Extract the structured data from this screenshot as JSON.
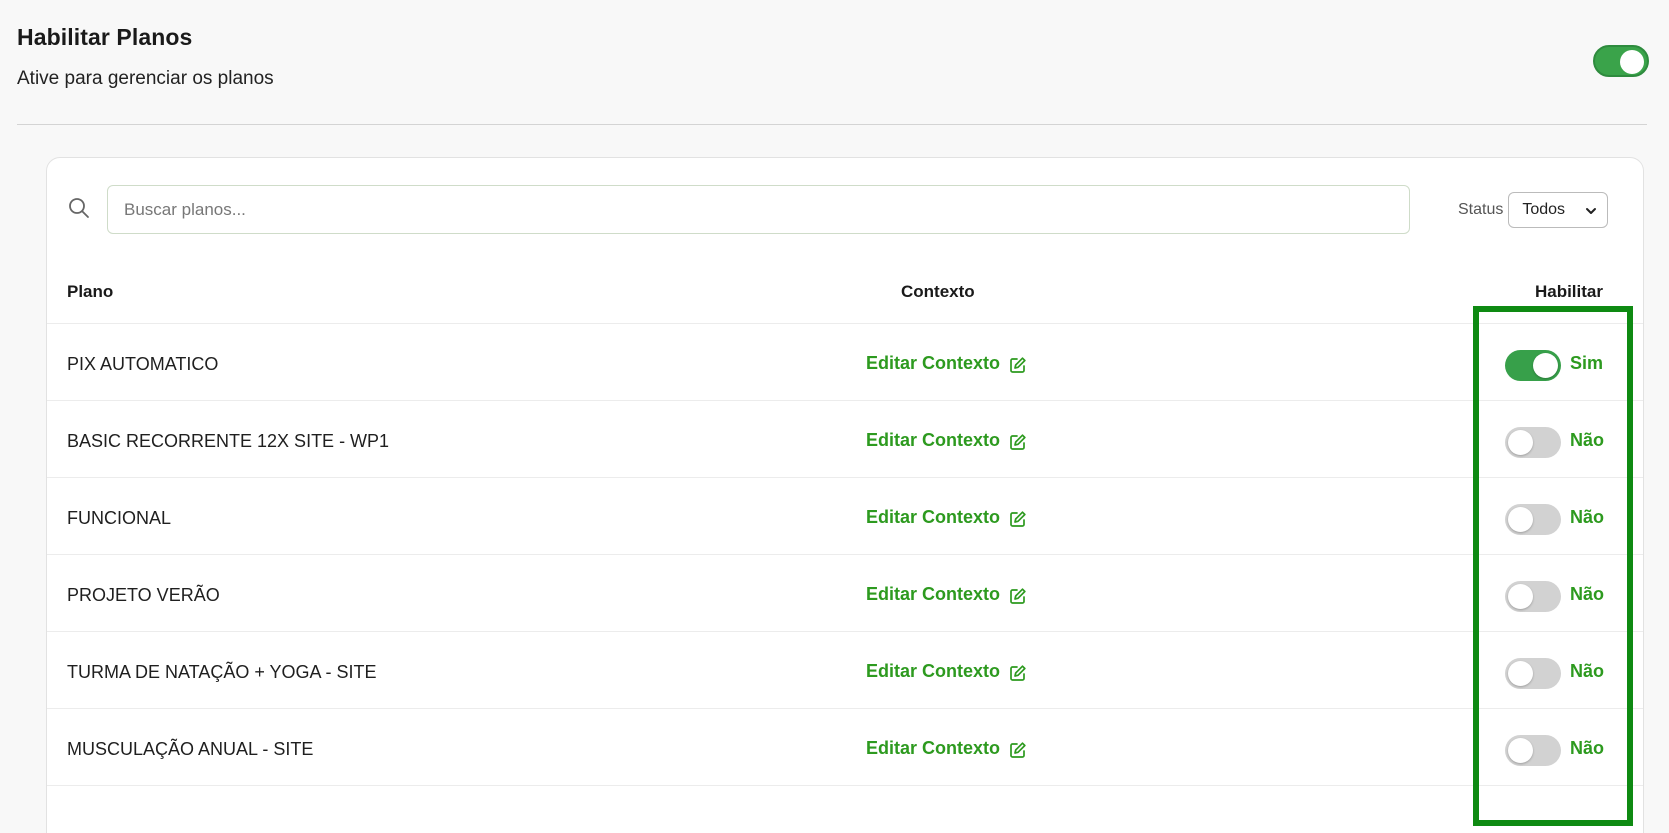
{
  "header": {
    "title": "Habilitar Planos",
    "subtitle": "Ative para gerenciar os planos",
    "master_toggle_on": true
  },
  "search": {
    "placeholder": "Buscar planos...",
    "value": ""
  },
  "status_filter": {
    "label": "Status",
    "selected": "Todos"
  },
  "table": {
    "headers": {
      "plano": "Plano",
      "contexto": "Contexto",
      "habilitar": "Habilitar"
    },
    "rows": [
      {
        "plan": "PIX AUTOMATICO",
        "action": "Editar Contexto",
        "enabled": true,
        "enabled_label": "Sim"
      },
      {
        "plan": "BASIC RECORRENTE 12X SITE - WP1",
        "action": "Editar Contexto",
        "enabled": false,
        "enabled_label": "Não"
      },
      {
        "plan": "FUNCIONAL",
        "action": "Editar Contexto",
        "enabled": false,
        "enabled_label": "Não"
      },
      {
        "plan": "PROJETO VERÃO",
        "action": "Editar Contexto",
        "enabled": false,
        "enabled_label": "Não"
      },
      {
        "plan": "TURMA DE NATAÇÃO + YOGA - SITE",
        "action": "Editar Contexto",
        "enabled": false,
        "enabled_label": "Não"
      },
      {
        "plan": "MUSCULAÇÃO ANUAL - SITE",
        "action": "Editar Contexto",
        "enabled": false,
        "enabled_label": "Não"
      }
    ]
  },
  "colors": {
    "accent_green": "#2d9a1f",
    "toggle_on": "#37a04a",
    "toggle_off": "#d2d2d2",
    "highlight_border": "#0e8a12"
  },
  "icons": {
    "search": "search-icon",
    "edit": "edit-icon",
    "dropdown": "chevron-down-icon"
  }
}
